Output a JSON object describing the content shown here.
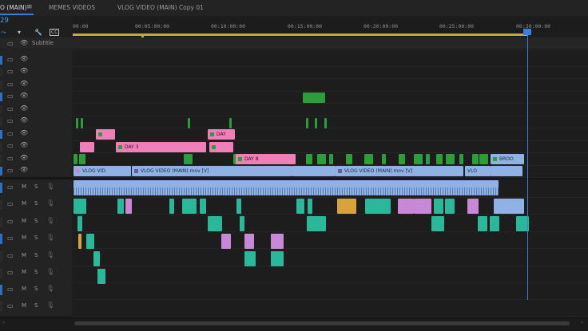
{
  "tabs": [
    {
      "label": "O (MAIN)",
      "active": true
    },
    {
      "label": "MEMES VIDEOS",
      "active": false
    },
    {
      "label": "VLOG VIDEO (MAIN) Copy 01",
      "active": false
    }
  ],
  "timecode": "29",
  "ruler": {
    "ticks": [
      "00:00",
      "00:05:00:00",
      "00:10:00:00",
      "00:15:00:00",
      "00:20:00:00",
      "00:25:00:00",
      "00:30:00:00"
    ]
  },
  "subtitle_track": {
    "label": "Subtitle"
  },
  "audio_track_buttons": {
    "mute": "M",
    "solo": "S"
  },
  "clip_labels": {
    "day3": "DAY 3",
    "day": "DAY",
    "day8": "DAY 8",
    "vlog_vid": "VLOG VID",
    "vlog_main_1": "VLOG VIDEO (MAIN).mov [V]",
    "vlog_main_2": "VLOG VIDEO (MAIN).mov [V]",
    "vlo": "VLO",
    "broo": "BROO"
  },
  "colors": {
    "accent": "#2f7fd8",
    "playhead": "#3d7ed8",
    "pink_clip": "#ef7fb8",
    "blue_clip": "#8fb1e6",
    "green_clip": "#2c9d3a",
    "teal_clip": "#2bb89a",
    "purple_clip": "#c887d7",
    "workarea": "#c6a83a"
  }
}
